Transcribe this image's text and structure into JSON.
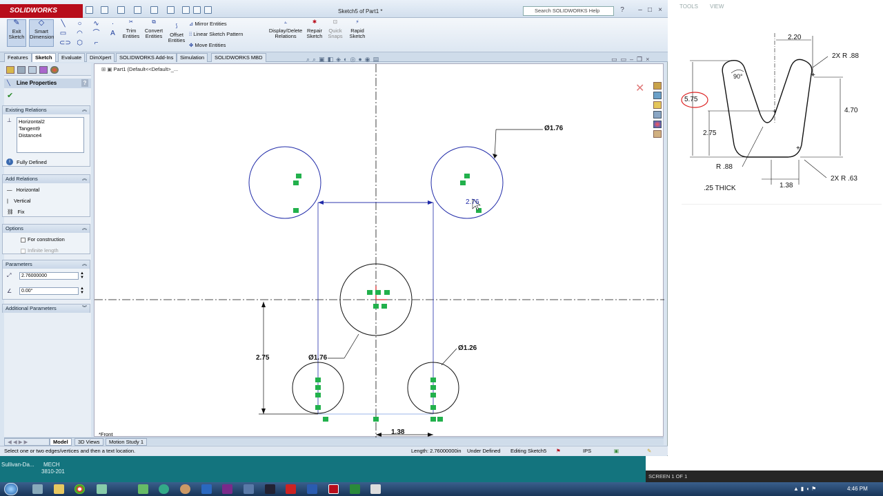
{
  "window": {
    "app_name": "SOLIDWORKS",
    "title": "Sketch5 of Part1 *",
    "search_placeholder": "Search SOLIDWORKS Help"
  },
  "ribbon": {
    "exit_sketch": "Exit Sketch",
    "smart_dimension": "Smart Dimension",
    "trim_entities": "Trim Entities",
    "convert_entities": "Convert Entities",
    "offset_entities": "Offset Entities",
    "mirror_entities": "Mirror Entities",
    "linear_sketch_pattern": "Linear Sketch Pattern",
    "move_entities": "Move Entities",
    "display_delete_relations": "Display/Delete Relations",
    "repair_sketch": "Repair Sketch",
    "quick_snaps": "Quick Snaps",
    "rapid_sketch": "Rapid Sketch"
  },
  "tabs": [
    "Features",
    "Sketch",
    "Evaluate",
    "DimXpert",
    "SOLIDWORKS Add-Ins",
    "Simulation",
    "SOLIDWORKS MBD"
  ],
  "property_manager": {
    "title": "Line Properties",
    "existing_relations": {
      "header": "Existing Relations",
      "items": [
        "Horizontal2",
        "Tangent9",
        "Distance4"
      ],
      "status": "Fully Defined"
    },
    "add_relations": {
      "header": "Add Relations",
      "items": [
        "Horizontal",
        "Vertical",
        "Fix"
      ]
    },
    "options": {
      "header": "Options",
      "for_construction": "For construction",
      "infinite_length": "Infinite length"
    },
    "parameters": {
      "header": "Parameters",
      "length": "2.76000000",
      "angle": "0.00°"
    },
    "additional_parameters": "Additional Parameters"
  },
  "canvas": {
    "tree_label": "Part1  (Default<<Default>_...",
    "view_label": "*Front",
    "dims": {
      "d_top_right": "Ø1.76",
      "d_bottom_left": "Ø1.76",
      "d_bottom_right": "Ø1.26",
      "active_dim": "2.76",
      "vertical_dim": "2.75",
      "horizontal_dim": "1.38"
    }
  },
  "bottom_tabs": [
    "Model",
    "3D Views",
    "Motion Study 1"
  ],
  "status_bar": {
    "hint": "Select one or two edges/vertices and then a text location.",
    "length": "Length: 2.76000000in",
    "state": "Under Defined",
    "editing": "Editing Sketch5",
    "units": "IPS"
  },
  "desktop": {
    "user": "Sullivan-Da...",
    "course_line1": "MECH",
    "course_line2": "3810-201",
    "screen_label": "SCREEN 1 OF 1",
    "clock": "4:46 PM"
  },
  "reference_drawing": {
    "top_menu": [
      "TOOLS",
      "VIEW"
    ],
    "dims": {
      "width_top": "2.20",
      "radius_top": "2X R .88",
      "height_total": "5.75",
      "angle": "90°",
      "height_right": "4.70",
      "height_left": "2.75",
      "radius_inner": "R .88",
      "radius_bottom": "2X R .63",
      "width_bottom": "1.38",
      "thickness": ".25 THICK"
    }
  },
  "colors": {
    "accent_red": "#b80d1b",
    "sketch_blue": "#1f2aa8",
    "relation_green": "#22b14c",
    "teal": "#13747e"
  }
}
